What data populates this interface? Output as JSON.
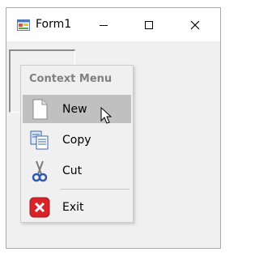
{
  "window": {
    "title": "Form1",
    "app_icon": "form-icon",
    "controls": {
      "minimize_icon": "minimize-icon",
      "maximize_icon": "maximize-icon",
      "close_icon": "close-icon"
    }
  },
  "context_menu": {
    "header": "Context Menu",
    "items": [
      {
        "label": "New",
        "icon": "new-document-icon",
        "highlighted": true
      },
      {
        "label": "Copy",
        "icon": "copy-icon",
        "highlighted": false
      },
      {
        "label": "Cut",
        "icon": "scissors-icon",
        "highlighted": false
      },
      {
        "label": "Exit",
        "icon": "exit-icon",
        "highlighted": false
      }
    ]
  },
  "colors": {
    "window_bg": "#f0f0f0",
    "titlebar_bg": "#ffffff",
    "menu_highlight": "#c0c0c0",
    "menu_header_text": "#808080",
    "exit_red": "#d9232a"
  }
}
